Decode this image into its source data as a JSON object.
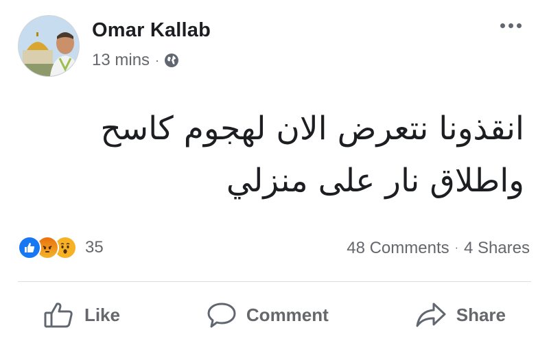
{
  "post": {
    "author": "Omar Kallab",
    "timestamp": "13 mins",
    "meta_separator": "·",
    "privacy_icon": "globe-icon",
    "more_icon": "more-options-icon",
    "text_lines": [
      "انقذونا نتعرض الان لهجوم كاسح",
      "واطلاق نار على منزلي"
    ]
  },
  "engagement": {
    "reaction_icons": [
      "like-reaction-icon",
      "angry-reaction-icon",
      "wow-reaction-icon"
    ],
    "reaction_count": "35",
    "comments": "48 Comments",
    "separator": "·",
    "shares": "4 Shares"
  },
  "actions": {
    "like": {
      "label": "Like",
      "icon": "thumbs-up-icon"
    },
    "comment": {
      "label": "Comment",
      "icon": "comment-icon"
    },
    "share": {
      "label": "Share",
      "icon": "share-icon"
    }
  },
  "colors": {
    "like_blue": "#1877f2",
    "secondary_text": "#65676b",
    "primary_text": "#1c1e21",
    "divider": "#dadde1"
  }
}
